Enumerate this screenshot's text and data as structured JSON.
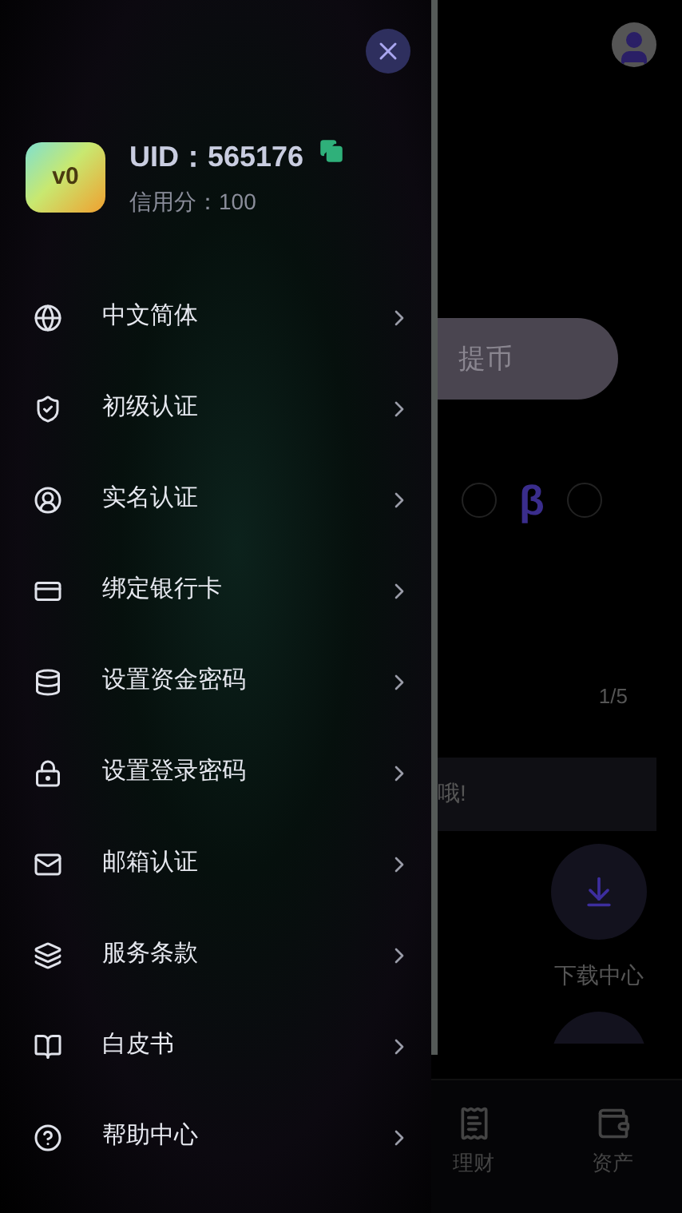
{
  "page": {
    "withdraw_button": "提币",
    "symbol": "β",
    "slide_counter": "1/5",
    "notice": "哦!",
    "shortcut": {
      "label": "下载中心"
    },
    "bottom_nav": [
      {
        "label": "理财",
        "selected": false
      },
      {
        "label": "资产",
        "selected": false
      }
    ]
  },
  "drawer": {
    "profile": {
      "uid": "UID：565176",
      "credit": "信用分：100",
      "badge": "v0"
    },
    "menu": [
      {
        "label": "中文简体"
      },
      {
        "label": "初级认证"
      },
      {
        "label": "实名认证"
      },
      {
        "label": "绑定银行卡"
      },
      {
        "label": "设置资金密码"
      },
      {
        "label": "设置登录密码"
      },
      {
        "label": "邮箱认证"
      },
      {
        "label": "服务条款"
      },
      {
        "label": "白皮书"
      },
      {
        "label": "帮助中心"
      }
    ]
  }
}
